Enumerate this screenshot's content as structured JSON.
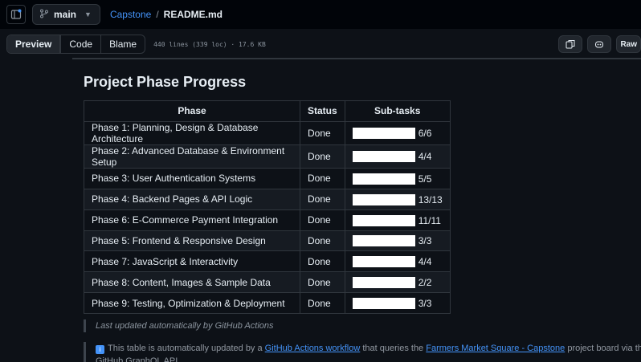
{
  "header": {
    "branch": "main",
    "repo": "Capstone",
    "separator": "/",
    "file": "README.md",
    "icons": [
      "sidebar-toggle-icon",
      "git-branch-icon",
      "chevron-down-icon"
    ]
  },
  "filebar": {
    "tabs": [
      "Preview",
      "Code",
      "Blame"
    ],
    "active_tab": "Preview",
    "info": "440 lines (339 loc) · 17.6 KB",
    "raw_label": "Raw",
    "icons": [
      "copy-icon",
      "copilot-icon"
    ]
  },
  "readme": {
    "heading": "Project Phase Progress",
    "table": {
      "headers": [
        "Phase",
        "Status",
        "Sub-tasks"
      ],
      "rows": [
        {
          "phase": "Phase 1: Planning, Design & Database Architecture",
          "status": "Done",
          "subtasks": "6/6",
          "progress": 1.0
        },
        {
          "phase": "Phase 2: Advanced Database & Environment Setup",
          "status": "Done",
          "subtasks": "4/4",
          "progress": 1.0
        },
        {
          "phase": "Phase 3: User Authentication Systems",
          "status": "Done",
          "subtasks": "5/5",
          "progress": 1.0
        },
        {
          "phase": "Phase 4: Backend Pages & API Logic",
          "status": "Done",
          "subtasks": "13/13",
          "progress": 1.0
        },
        {
          "phase": "Phase 6: E-Commerce Payment Integration",
          "status": "Done",
          "subtasks": "11/11",
          "progress": 1.0
        },
        {
          "phase": "Phase 5: Frontend & Responsive Design",
          "status": "Done",
          "subtasks": "3/3",
          "progress": 1.0
        },
        {
          "phase": "Phase 7: JavaScript & Interactivity",
          "status": "Done",
          "subtasks": "4/4",
          "progress": 1.0
        },
        {
          "phase": "Phase 8: Content, Images & Sample Data",
          "status": "Done",
          "subtasks": "2/2",
          "progress": 1.0
        },
        {
          "phase": "Phase 9: Testing, Optimization & Deployment",
          "status": "Done",
          "subtasks": "3/3",
          "progress": 1.0
        }
      ]
    },
    "note_updated": "Last updated automatically by GitHub Actions",
    "note_info": {
      "text1": "This table is automatically updated by a",
      "link1": "GitHub Actions workflow",
      "text2": "that queries the",
      "link2": "Farmers Market Square - Capstone",
      "text3": "project board via the GitHub GraphQL API."
    }
  },
  "colors": {
    "background": "#0d1117",
    "link": "#4493f8",
    "border": "#30363d",
    "bar": "#ffffff"
  }
}
